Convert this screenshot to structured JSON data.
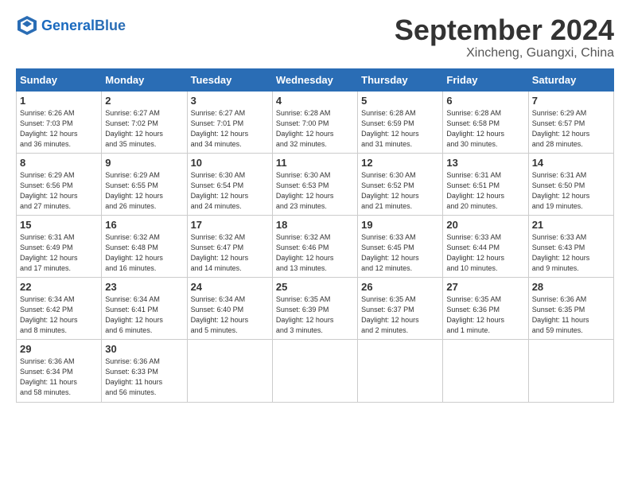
{
  "header": {
    "logo_general": "General",
    "logo_blue": "Blue",
    "month_title": "September 2024",
    "location": "Xincheng, Guangxi, China"
  },
  "columns": [
    "Sunday",
    "Monday",
    "Tuesday",
    "Wednesday",
    "Thursday",
    "Friday",
    "Saturday"
  ],
  "weeks": [
    [
      {
        "day": "1",
        "info": "Sunrise: 6:26 AM\nSunset: 7:03 PM\nDaylight: 12 hours\nand 36 minutes."
      },
      {
        "day": "2",
        "info": "Sunrise: 6:27 AM\nSunset: 7:02 PM\nDaylight: 12 hours\nand 35 minutes."
      },
      {
        "day": "3",
        "info": "Sunrise: 6:27 AM\nSunset: 7:01 PM\nDaylight: 12 hours\nand 34 minutes."
      },
      {
        "day": "4",
        "info": "Sunrise: 6:28 AM\nSunset: 7:00 PM\nDaylight: 12 hours\nand 32 minutes."
      },
      {
        "day": "5",
        "info": "Sunrise: 6:28 AM\nSunset: 6:59 PM\nDaylight: 12 hours\nand 31 minutes."
      },
      {
        "day": "6",
        "info": "Sunrise: 6:28 AM\nSunset: 6:58 PM\nDaylight: 12 hours\nand 30 minutes."
      },
      {
        "day": "7",
        "info": "Sunrise: 6:29 AM\nSunset: 6:57 PM\nDaylight: 12 hours\nand 28 minutes."
      }
    ],
    [
      {
        "day": "8",
        "info": "Sunrise: 6:29 AM\nSunset: 6:56 PM\nDaylight: 12 hours\nand 27 minutes."
      },
      {
        "day": "9",
        "info": "Sunrise: 6:29 AM\nSunset: 6:55 PM\nDaylight: 12 hours\nand 26 minutes."
      },
      {
        "day": "10",
        "info": "Sunrise: 6:30 AM\nSunset: 6:54 PM\nDaylight: 12 hours\nand 24 minutes."
      },
      {
        "day": "11",
        "info": "Sunrise: 6:30 AM\nSunset: 6:53 PM\nDaylight: 12 hours\nand 23 minutes."
      },
      {
        "day": "12",
        "info": "Sunrise: 6:30 AM\nSunset: 6:52 PM\nDaylight: 12 hours\nand 21 minutes."
      },
      {
        "day": "13",
        "info": "Sunrise: 6:31 AM\nSunset: 6:51 PM\nDaylight: 12 hours\nand 20 minutes."
      },
      {
        "day": "14",
        "info": "Sunrise: 6:31 AM\nSunset: 6:50 PM\nDaylight: 12 hours\nand 19 minutes."
      }
    ],
    [
      {
        "day": "15",
        "info": "Sunrise: 6:31 AM\nSunset: 6:49 PM\nDaylight: 12 hours\nand 17 minutes."
      },
      {
        "day": "16",
        "info": "Sunrise: 6:32 AM\nSunset: 6:48 PM\nDaylight: 12 hours\nand 16 minutes."
      },
      {
        "day": "17",
        "info": "Sunrise: 6:32 AM\nSunset: 6:47 PM\nDaylight: 12 hours\nand 14 minutes."
      },
      {
        "day": "18",
        "info": "Sunrise: 6:32 AM\nSunset: 6:46 PM\nDaylight: 12 hours\nand 13 minutes."
      },
      {
        "day": "19",
        "info": "Sunrise: 6:33 AM\nSunset: 6:45 PM\nDaylight: 12 hours\nand 12 minutes."
      },
      {
        "day": "20",
        "info": "Sunrise: 6:33 AM\nSunset: 6:44 PM\nDaylight: 12 hours\nand 10 minutes."
      },
      {
        "day": "21",
        "info": "Sunrise: 6:33 AM\nSunset: 6:43 PM\nDaylight: 12 hours\nand 9 minutes."
      }
    ],
    [
      {
        "day": "22",
        "info": "Sunrise: 6:34 AM\nSunset: 6:42 PM\nDaylight: 12 hours\nand 8 minutes."
      },
      {
        "day": "23",
        "info": "Sunrise: 6:34 AM\nSunset: 6:41 PM\nDaylight: 12 hours\nand 6 minutes."
      },
      {
        "day": "24",
        "info": "Sunrise: 6:34 AM\nSunset: 6:40 PM\nDaylight: 12 hours\nand 5 minutes."
      },
      {
        "day": "25",
        "info": "Sunrise: 6:35 AM\nSunset: 6:39 PM\nDaylight: 12 hours\nand 3 minutes."
      },
      {
        "day": "26",
        "info": "Sunrise: 6:35 AM\nSunset: 6:37 PM\nDaylight: 12 hours\nand 2 minutes."
      },
      {
        "day": "27",
        "info": "Sunrise: 6:35 AM\nSunset: 6:36 PM\nDaylight: 12 hours\nand 1 minute."
      },
      {
        "day": "28",
        "info": "Sunrise: 6:36 AM\nSunset: 6:35 PM\nDaylight: 11 hours\nand 59 minutes."
      }
    ],
    [
      {
        "day": "29",
        "info": "Sunrise: 6:36 AM\nSunset: 6:34 PM\nDaylight: 11 hours\nand 58 minutes."
      },
      {
        "day": "30",
        "info": "Sunrise: 6:36 AM\nSunset: 6:33 PM\nDaylight: 11 hours\nand 56 minutes."
      },
      {
        "day": "",
        "info": ""
      },
      {
        "day": "",
        "info": ""
      },
      {
        "day": "",
        "info": ""
      },
      {
        "day": "",
        "info": ""
      },
      {
        "day": "",
        "info": ""
      }
    ]
  ]
}
